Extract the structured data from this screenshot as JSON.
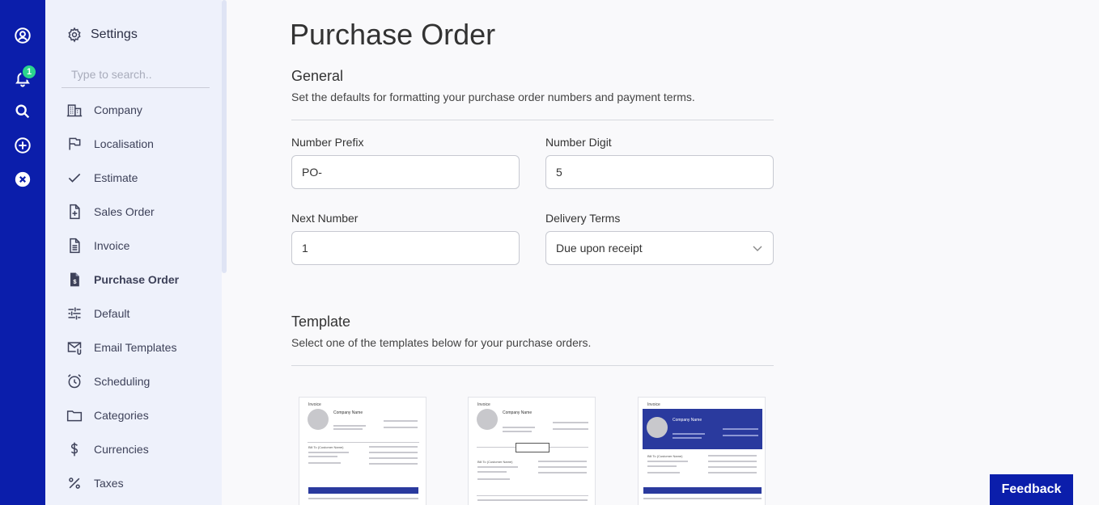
{
  "rail": {
    "items": [
      {
        "icon": "user-circle-icon"
      },
      {
        "icon": "bell-icon"
      },
      {
        "icon": "search-icon"
      },
      {
        "icon": "plus-circle-icon"
      },
      {
        "icon": "close-circle-icon"
      }
    ],
    "notification_count": "1",
    "background": "#0b1eab"
  },
  "sidebar": {
    "title": "Settings",
    "search_placeholder": "Type to search..",
    "items": [
      {
        "label": "Company",
        "icon": "building-icon"
      },
      {
        "label": "Localisation",
        "icon": "flag-icon"
      },
      {
        "label": "Estimate",
        "icon": "check-icon"
      },
      {
        "label": "Sales Order",
        "icon": "file-plus-icon"
      },
      {
        "label": "Invoice",
        "icon": "file-text-icon"
      },
      {
        "label": "Purchase Order",
        "icon": "file-dollar-icon",
        "active": true
      },
      {
        "label": "Default",
        "icon": "sliders-icon"
      },
      {
        "label": "Email Templates",
        "icon": "mail-attachment-icon"
      },
      {
        "label": "Scheduling",
        "icon": "alarm-clock-icon"
      },
      {
        "label": "Categories",
        "icon": "folder-icon"
      },
      {
        "label": "Currencies",
        "icon": "dollar-icon"
      },
      {
        "label": "Taxes",
        "icon": "percent-icon"
      }
    ]
  },
  "main": {
    "title": "Purchase Order",
    "general": {
      "title": "General",
      "description": "Set the defaults for formatting your purchase order numbers and payment terms.",
      "fields": {
        "number_prefix": {
          "label": "Number Prefix",
          "value": "PO-"
        },
        "number_digit": {
          "label": "Number Digit",
          "value": "5"
        },
        "next_number": {
          "label": "Next Number",
          "value": "1"
        },
        "delivery_terms": {
          "label": "Delivery Terms",
          "value": "Due upon receipt"
        }
      }
    },
    "template": {
      "title": "Template",
      "description": "Select one of the templates below for your purchase orders.",
      "thumbnails": [
        {
          "heading": "Invoice",
          "company": "Company Name",
          "bill_to": "Bill To (Customer Name)"
        },
        {
          "heading": "Invoice",
          "company": "Company Name",
          "bill_to": "Bill To (Customer Name)"
        },
        {
          "heading": "Invoice",
          "company": "Company Name",
          "bill_to": "Bill To (Customer Name)"
        }
      ]
    }
  },
  "feedback_label": "Feedback",
  "accent": "#0b1eab"
}
